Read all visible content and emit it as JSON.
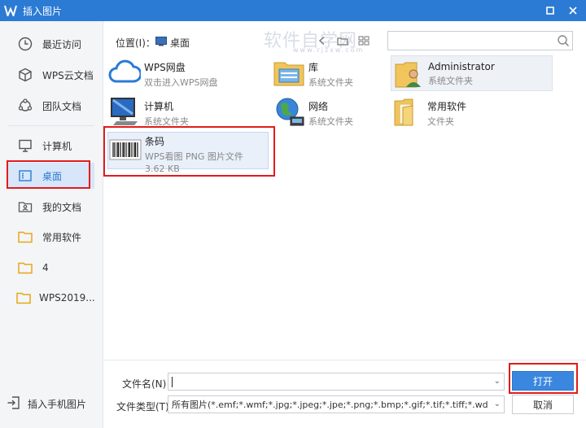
{
  "window": {
    "title": "插入图片"
  },
  "sidebar": {
    "items": [
      {
        "label": "最近访问"
      },
      {
        "label": "WPS云文档"
      },
      {
        "label": "团队文档"
      },
      {
        "label": "计算机"
      },
      {
        "label": "桌面"
      },
      {
        "label": "我的文档"
      },
      {
        "label": "常用软件"
      },
      {
        "label": "4"
      },
      {
        "label": "WPS2019..."
      }
    ],
    "selected": "桌面",
    "bottom_label": "插入手机图片"
  },
  "toolbar": {
    "location_label": "位置(I)：",
    "location_value": "桌面",
    "search_placeholder": ""
  },
  "watermark": {
    "text": "软件自学网",
    "sub": "www.rjzxw.com"
  },
  "files": [
    {
      "name": "WPS网盘",
      "sub": "双击进入WPS网盘",
      "icon": "cloud-icon"
    },
    {
      "name": "库",
      "sub": "系统文件夹",
      "icon": "library-folder-icon"
    },
    {
      "name": "Administrator",
      "sub": "系统文件夹",
      "icon": "user-folder-icon"
    },
    {
      "name": "计算机",
      "sub": "系统文件夹",
      "icon": "computer-icon"
    },
    {
      "name": "网络",
      "sub": "系统文件夹",
      "icon": "network-globe-icon"
    },
    {
      "name": "常用软件",
      "sub": "文件夹",
      "icon": "folder-icon"
    },
    {
      "name": "条码",
      "sub": "WPS看图 PNG 图片文件",
      "size": "3.62 KB",
      "icon": "barcode-image-icon"
    }
  ],
  "footer": {
    "filename_label": "文件名(N)：",
    "filename_value": "",
    "filetype_label": "文件类型(T)：",
    "filetype_value": "所有图片(*.emf;*.wmf;*.jpg;*.jpeg;*.jpe;*.png;*.bmp;*.gif;*.tif;*.tiff;*.wdp;*.svg)",
    "open_label": "打开",
    "cancel_label": "取消"
  },
  "colors": {
    "accent": "#2b7bd5",
    "highlight_box": "#e11c1c"
  }
}
